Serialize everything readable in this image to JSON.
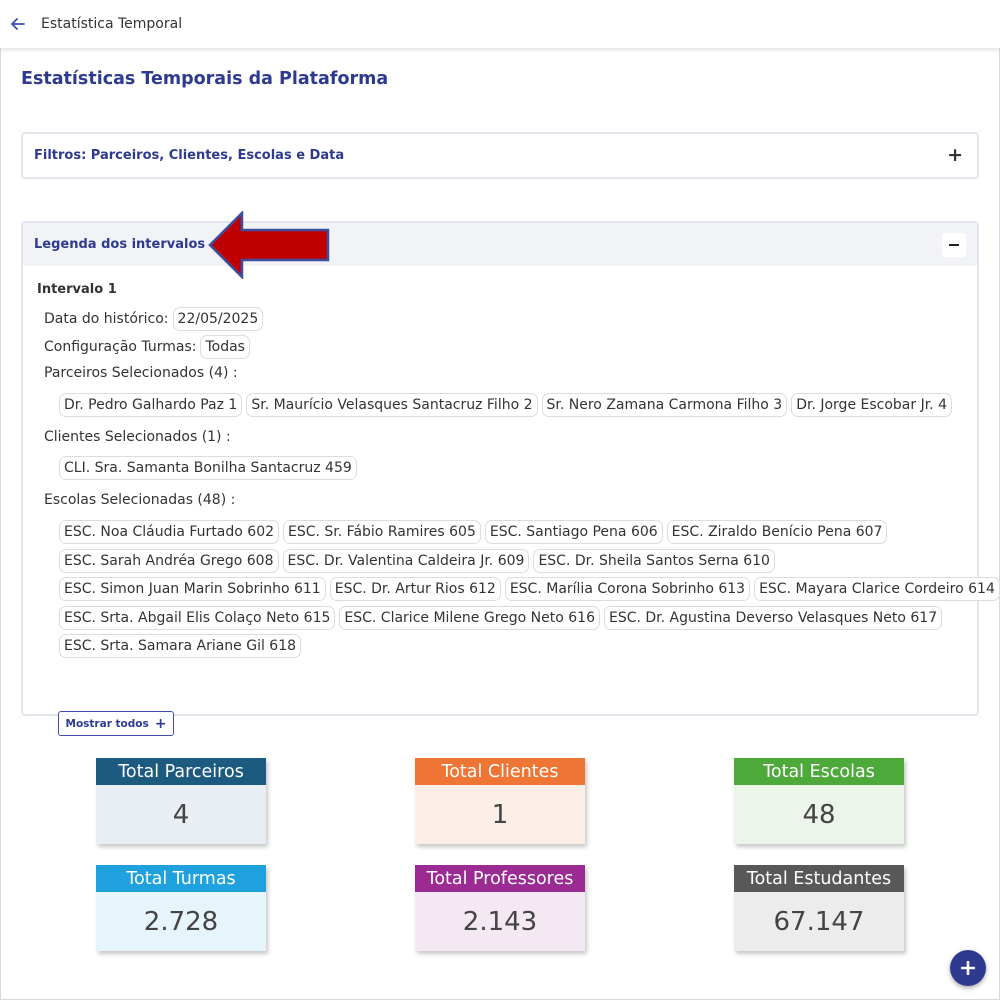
{
  "topbar": {
    "title": "Estatística Temporal"
  },
  "page": {
    "title": "Estatísticas Temporais da Plataforma"
  },
  "filters": {
    "label": "Filtros: Parceiros, Clientes, Escolas e Data",
    "toggle_symbol": "+"
  },
  "legend": {
    "label": "Legenda dos intervalos",
    "interval": {
      "title": "Intervalo 1",
      "history_date_label": "Data do histórico:",
      "history_date": "22/05/2025",
      "class_config_label": "Configuração Turmas:",
      "class_config": "Todas",
      "partners_label": "Parceiros Selecionados (4) :",
      "partners": [
        "Dr. Pedro Galhardo Paz 1",
        "Sr. Maurício Velasques Santacruz Filho 2",
        "Sr. Nero Zamana Carmona Filho 3",
        "Dr. Jorge Escobar Jr. 4"
      ],
      "clients_label": "Clientes Selecionados (1) :",
      "clients": [
        "CLI. Sra. Samanta Bonilha Santacruz 459"
      ],
      "schools_label": "Escolas Selecionadas (48) :",
      "school_rows": [
        [
          "ESC. Noa Cláudia Furtado 602",
          "ESC. Sr. Fábio Ramires 605",
          "ESC. Santiago Pena 606",
          "ESC. Ziraldo Benício Pena 607"
        ],
        [
          "ESC. Sarah Andréa Grego 608",
          "ESC. Dr. Valentina Caldeira Jr. 609",
          "ESC. Dr. Sheila Santos Serna 610"
        ],
        [
          "ESC. Simon Juan Marin Sobrinho 611",
          "ESC. Dr. Artur Rios 612",
          "ESC. Marília Corona Sobrinho 613",
          "ESC. Mayara Clarice Cordeiro 614"
        ],
        [
          "ESC. Srta. Abgail Elis Colaço Neto 615",
          "ESC. Clarice Milene Grego Neto 616",
          "ESC. Dr. Agustina Deverso Velasques Neto 617"
        ],
        [
          "ESC. Srta. Samara Ariane Gil 618"
        ]
      ],
      "show_all_label": "Mostrar todos",
      "show_all_symbol": "+"
    }
  },
  "stats": [
    {
      "label": "Total Parceiros",
      "value": "4",
      "head_color": "#1d5a80",
      "body_color": "#e8eef3"
    },
    {
      "label": "Total Clientes",
      "value": "1",
      "head_color": "#ee7534",
      "body_color": "#fcefe8"
    },
    {
      "label": "Total Escolas",
      "value": "48",
      "head_color": "#4daa3a",
      "body_color": "#ebf5e9"
    },
    {
      "label": "Total Turmas",
      "value": "2.728",
      "head_color": "#1ea1dc",
      "body_color": "#e6f4fb"
    },
    {
      "label": "Total Professores",
      "value": "2.143",
      "head_color": "#9b2b93",
      "body_color": "#f4e8f3"
    },
    {
      "label": "Total Estudantes",
      "value": "67.147",
      "head_color": "#585858",
      "body_color": "#ececec"
    }
  ],
  "colors": {
    "accent": "#2e3a8f",
    "annotation_arrow": "#c00000"
  }
}
